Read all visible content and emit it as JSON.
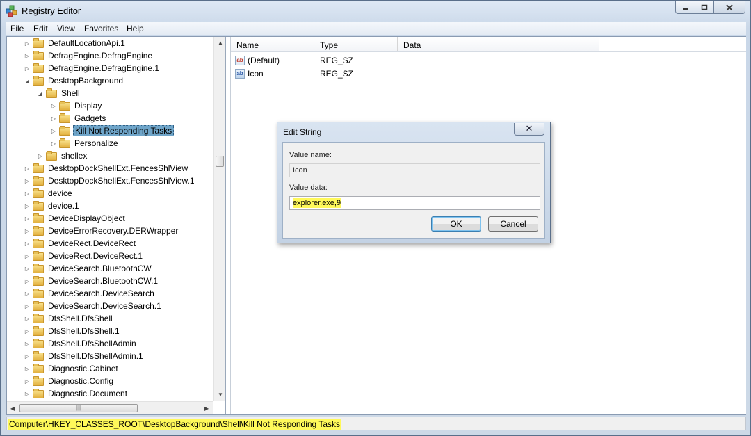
{
  "window": {
    "title": "Registry Editor"
  },
  "menu": [
    "File",
    "Edit",
    "View",
    "Favorites",
    "Help"
  ],
  "tree": [
    {
      "label": "DefaultLocationApi.1",
      "level": 0,
      "expander": "collapsed"
    },
    {
      "label": "DefragEngine.DefragEngine",
      "level": 0,
      "expander": "collapsed"
    },
    {
      "label": "DefragEngine.DefragEngine.1",
      "level": 0,
      "expander": "collapsed"
    },
    {
      "label": "DesktopBackground",
      "level": 0,
      "expander": "expanded"
    },
    {
      "label": "Shell",
      "level": 1,
      "expander": "expanded"
    },
    {
      "label": "Display",
      "level": 2,
      "expander": "collapsed"
    },
    {
      "label": "Gadgets",
      "level": 2,
      "expander": "collapsed"
    },
    {
      "label": "Kill Not Responding Tasks",
      "level": 2,
      "expander": "collapsed",
      "selected": true
    },
    {
      "label": "Personalize",
      "level": 2,
      "expander": "collapsed"
    },
    {
      "label": "shellex",
      "level": 1,
      "expander": "collapsed"
    },
    {
      "label": "DesktopDockShellExt.FencesShlView",
      "level": 0,
      "expander": "collapsed"
    },
    {
      "label": "DesktopDockShellExt.FencesShlView.1",
      "level": 0,
      "expander": "collapsed"
    },
    {
      "label": "device",
      "level": 0,
      "expander": "collapsed"
    },
    {
      "label": "device.1",
      "level": 0,
      "expander": "collapsed"
    },
    {
      "label": "DeviceDisplayObject",
      "level": 0,
      "expander": "collapsed"
    },
    {
      "label": "DeviceErrorRecovery.DERWrapper",
      "level": 0,
      "expander": "collapsed"
    },
    {
      "label": "DeviceRect.DeviceRect",
      "level": 0,
      "expander": "collapsed"
    },
    {
      "label": "DeviceRect.DeviceRect.1",
      "level": 0,
      "expander": "collapsed"
    },
    {
      "label": "DeviceSearch.BluetoothCW",
      "level": 0,
      "expander": "collapsed"
    },
    {
      "label": "DeviceSearch.BluetoothCW.1",
      "level": 0,
      "expander": "collapsed"
    },
    {
      "label": "DeviceSearch.DeviceSearch",
      "level": 0,
      "expander": "collapsed"
    },
    {
      "label": "DeviceSearch.DeviceSearch.1",
      "level": 0,
      "expander": "collapsed"
    },
    {
      "label": "DfsShell.DfsShell",
      "level": 0,
      "expander": "collapsed"
    },
    {
      "label": "DfsShell.DfsShell.1",
      "level": 0,
      "expander": "collapsed"
    },
    {
      "label": "DfsShell.DfsShellAdmin",
      "level": 0,
      "expander": "collapsed"
    },
    {
      "label": "DfsShell.DfsShellAdmin.1",
      "level": 0,
      "expander": "collapsed"
    },
    {
      "label": "Diagnostic.Cabinet",
      "level": 0,
      "expander": "collapsed"
    },
    {
      "label": "Diagnostic.Config",
      "level": 0,
      "expander": "collapsed"
    },
    {
      "label": "Diagnostic.Document",
      "level": 0,
      "expander": "collapsed"
    }
  ],
  "list": {
    "columns": [
      "Name",
      "Type",
      "Data"
    ],
    "rows": [
      {
        "name": "(Default)",
        "type": "REG_SZ",
        "data": "",
        "icon": "string-value-icon"
      },
      {
        "name": "Icon",
        "type": "REG_SZ",
        "data": "",
        "icon": "string-value-icon"
      }
    ]
  },
  "dialog": {
    "title": "Edit String",
    "close": "✕",
    "value_name_label": "Value name:",
    "value_name": "Icon",
    "value_data_label": "Value data:",
    "value_data": "explorer.exe,9",
    "ok": "OK",
    "cancel": "Cancel"
  },
  "statusbar": {
    "path": "Computer\\HKEY_CLASSES_ROOT\\DesktopBackground\\Shell\\Kill Not Responding Tasks"
  },
  "colors": {
    "selection": "#6fa5c9",
    "highlight": "#fff95a"
  }
}
